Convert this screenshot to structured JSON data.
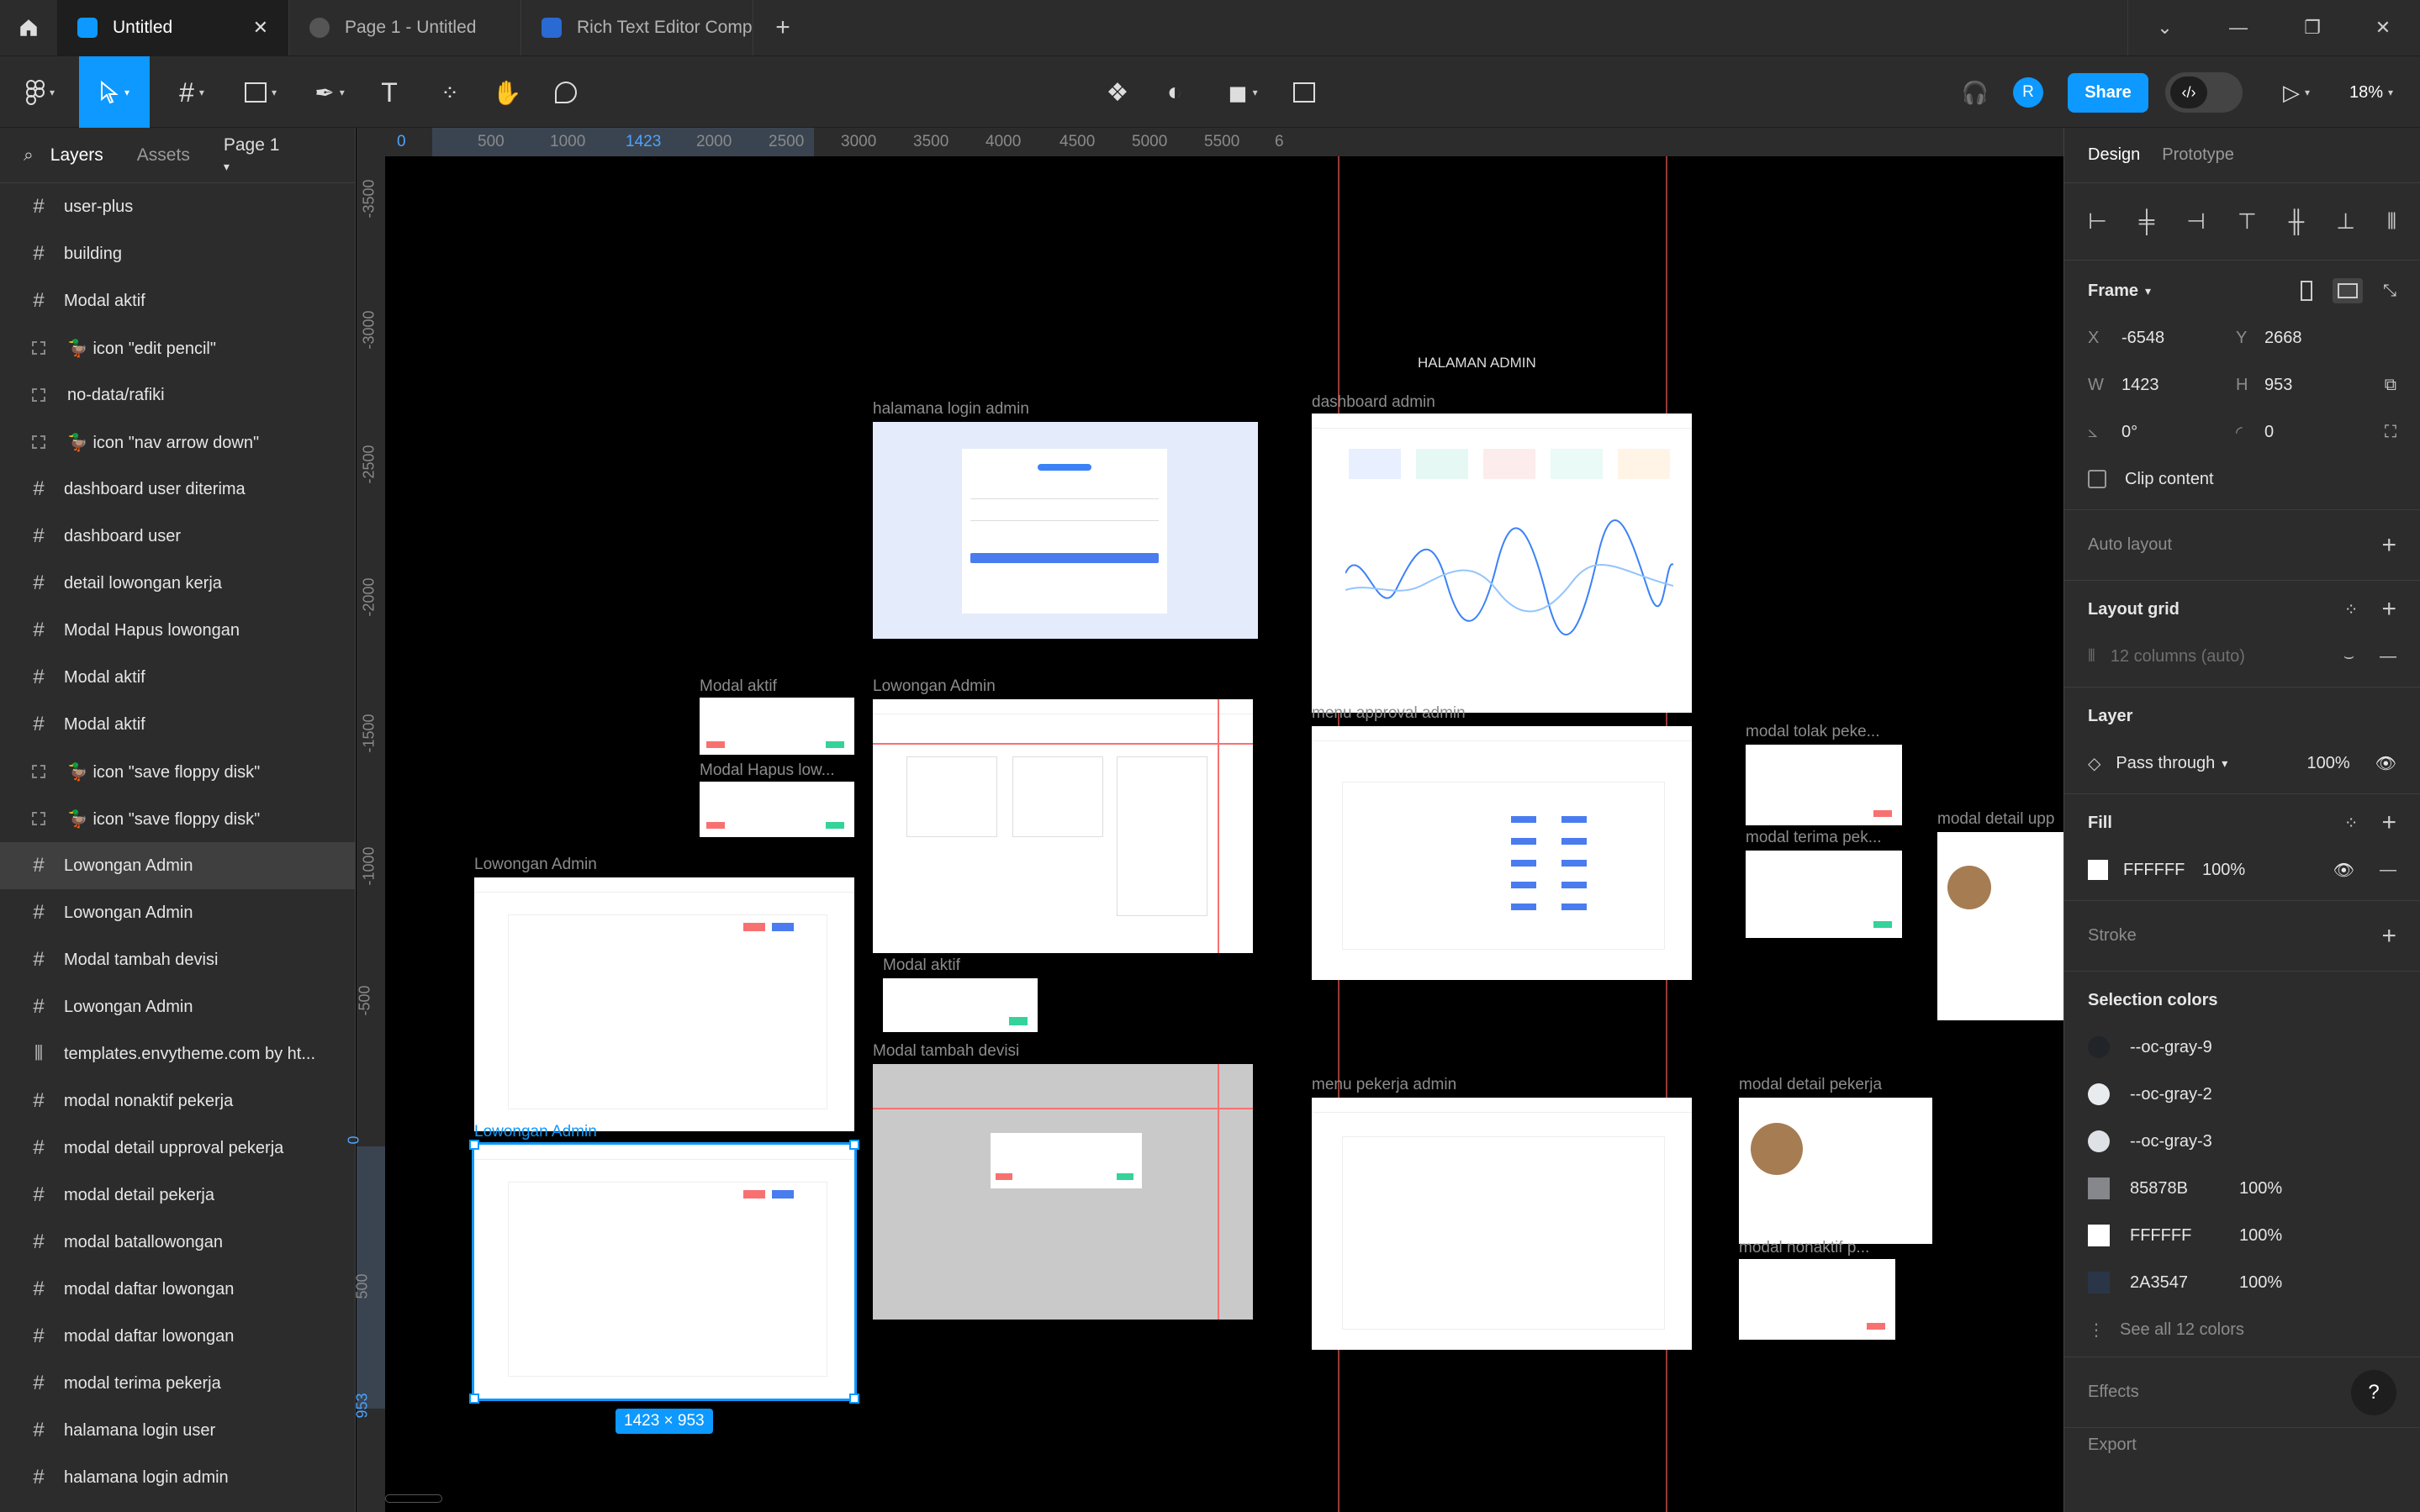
{
  "tabs": [
    {
      "label": "Untitled",
      "active": true,
      "icon_color": "#0d99ff"
    },
    {
      "label": "Page 1 - Untitled",
      "active": false,
      "icon_color": "#555555"
    },
    {
      "label": "Rich Text Editor Component Kit (Com",
      "active": false,
      "icon_color": "#2a6ad4"
    }
  ],
  "toolbar": {
    "share_label": "Share",
    "zoom_label": "18%",
    "avatar_letter": "R"
  },
  "left_panel": {
    "tab_layers": "Layers",
    "tab_assets": "Assets",
    "page_selector": "Page 1",
    "layers": [
      {
        "label": "user-plus",
        "icon": "frame-icon"
      },
      {
        "label": "building",
        "icon": "frame-icon"
      },
      {
        "label": "Modal aktif",
        "icon": "frame-icon"
      },
      {
        "label": "🦆 icon \"edit pencil\"",
        "icon": "component-dashed-icon"
      },
      {
        "label": "no-data/rafiki",
        "icon": "component-dashed-icon"
      },
      {
        "label": "🦆 icon \"nav arrow down\"",
        "icon": "component-dashed-icon"
      },
      {
        "label": "dashboard user diterima",
        "icon": "frame-icon"
      },
      {
        "label": "dashboard user",
        "icon": "frame-icon"
      },
      {
        "label": "detail lowongan kerja",
        "icon": "frame-icon"
      },
      {
        "label": "Modal Hapus lowongan",
        "icon": "frame-icon"
      },
      {
        "label": "Modal aktif",
        "icon": "frame-icon"
      },
      {
        "label": "Modal aktif",
        "icon": "frame-icon"
      },
      {
        "label": "🦆 icon \"save floppy disk\"",
        "icon": "component-dashed-icon"
      },
      {
        "label": "🦆 icon \"save floppy disk\"",
        "icon": "component-dashed-icon"
      },
      {
        "label": "Lowongan Admin",
        "icon": "frame-icon",
        "highlight": true
      },
      {
        "label": "Lowongan Admin",
        "icon": "frame-icon"
      },
      {
        "label": "Modal tambah devisi",
        "icon": "frame-icon"
      },
      {
        "label": "Lowongan Admin",
        "icon": "frame-icon"
      },
      {
        "label": "templates.envytheme.com by ht...",
        "icon": "columns-icon"
      },
      {
        "label": "modal nonaktif pekerja",
        "icon": "frame-icon"
      },
      {
        "label": "modal detail upproval pekerja",
        "icon": "frame-icon"
      },
      {
        "label": "modal detail pekerja",
        "icon": "frame-icon"
      },
      {
        "label": "modal batallowongan",
        "icon": "frame-icon"
      },
      {
        "label": "modal daftar lowongan",
        "icon": "frame-icon"
      },
      {
        "label": "modal daftar lowongan",
        "icon": "frame-icon"
      },
      {
        "label": "modal terima pekerja",
        "icon": "frame-icon"
      },
      {
        "label": "halamana login user",
        "icon": "frame-icon"
      },
      {
        "label": "halamana login admin",
        "icon": "frame-icon"
      }
    ]
  },
  "ruler_top": [
    "0",
    "500",
    "1000",
    "1423",
    "2000",
    "2500",
    "3000",
    "3500",
    "4000",
    "4500",
    "5000",
    "5500",
    "6"
  ],
  "ruler_left": [
    "-3500",
    "-3000",
    "-2500",
    "-2000",
    "-1500",
    "-1000",
    "-500",
    "0",
    "500",
    "953"
  ],
  "canvas": {
    "section_title": "HALAMAN ADMIN",
    "selection_size": "1423 × 953",
    "frames": [
      {
        "label": "halamana login admin",
        "kind": "login"
      },
      {
        "label": "dashboard admin",
        "kind": "dashboard"
      },
      {
        "label": "Modal aktif",
        "kind": "modal"
      },
      {
        "label": "Modal Hapus low...",
        "kind": "modal"
      },
      {
        "label": "Lowongan Admin",
        "kind": "cards"
      },
      {
        "label": "menu approval admin",
        "kind": "table"
      },
      {
        "label": "modal tolak peke...",
        "kind": "modal"
      },
      {
        "label": "modal terima pek...",
        "kind": "modal"
      },
      {
        "label": "modal detail upp",
        "kind": "detail"
      },
      {
        "label": "Lowongan Admin",
        "kind": "form"
      },
      {
        "label": "Modal aktif",
        "kind": "modal"
      },
      {
        "label": "Modal tambah devisi",
        "kind": "cards"
      },
      {
        "label": "Lowongan Admin",
        "kind": "form"
      },
      {
        "label": "menu pekerja admin",
        "kind": "table"
      },
      {
        "label": "modal detail pekerja",
        "kind": "detail"
      },
      {
        "label": "modal nonaktif p...",
        "kind": "modal"
      }
    ]
  },
  "right_panel": {
    "tab_design": "Design",
    "tab_prototype": "Prototype",
    "frame_title": "Frame",
    "x_label": "X",
    "x": "-6548",
    "y_label": "Y",
    "y": "2668",
    "w_label": "W",
    "w": "1423",
    "h_label": "H",
    "h": "953",
    "rotation": "0°",
    "radius": "0",
    "clip_content": "Clip content",
    "auto_layout": "Auto layout",
    "layout_grid": "Layout grid",
    "grid_value": "12 columns (auto)",
    "layer_title": "Layer",
    "blend": "Pass through",
    "opacity": "100%",
    "fill_title": "Fill",
    "fill_hex": "FFFFFF",
    "fill_opacity": "100%",
    "stroke": "Stroke",
    "selection_colors": "Selection colors",
    "colors": [
      {
        "name": "--oc-gray-9",
        "swatch": "#212529",
        "opacity": ""
      },
      {
        "name": "--oc-gray-2",
        "swatch": "#e9ecef",
        "opacity": ""
      },
      {
        "name": "--oc-gray-3",
        "swatch": "#dee2e6",
        "opacity": ""
      },
      {
        "name": "85878B",
        "swatch": "#85878b",
        "opacity": "100%"
      },
      {
        "name": "FFFFFF",
        "swatch": "#ffffff",
        "opacity": "100%"
      },
      {
        "name": "2A3547",
        "swatch": "#2a3547",
        "opacity": "100%"
      }
    ],
    "see_all": "See all 12 colors",
    "effects": "Effects",
    "export": "Export"
  }
}
